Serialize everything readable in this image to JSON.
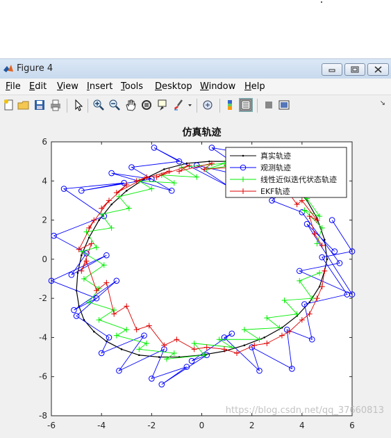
{
  "window": {
    "title": "Figure 4"
  },
  "menu": [
    "File",
    "Edit",
    "View",
    "Insert",
    "Tools",
    "Desktop",
    "Window",
    "Help"
  ],
  "menu_underline": [
    "F",
    "E",
    "V",
    "I",
    "T",
    "D",
    "W",
    "H"
  ],
  "toolbar_icons": [
    "new-figure-icon",
    "open-icon",
    "save-icon",
    "print-icon",
    "pointer-icon",
    "zoom-in-icon",
    "zoom-out-icon",
    "pan-icon",
    "rotate-3d-icon",
    "data-cursor-icon",
    "brush-icon",
    "brush-dropdown-icon",
    "link-plot-icon",
    "colorbar-icon",
    "legend-icon",
    "hide-plot-tools-icon",
    "show-plot-tools-icon"
  ],
  "chart_data": {
    "type": "line",
    "title": "仿真轨迹",
    "xlabel": "",
    "ylabel": "",
    "xlim": [
      -6,
      6
    ],
    "ylim": [
      -8,
      6
    ],
    "xticks": [
      "-6",
      "-4",
      "-2",
      "0",
      "2",
      "4",
      "6"
    ],
    "yticks": [
      "6",
      "4",
      "2",
      "0",
      "-2",
      "-4",
      "-6",
      "-8"
    ],
    "legend_position": "top-right",
    "legend": [
      "真实轨迹",
      "观测轨迹",
      "线性近似迭代状态轨迹",
      "EKF轨迹"
    ],
    "series": [
      {
        "name": "真实轨迹",
        "color": "#000000",
        "marker": "dot",
        "x": [
          5.0,
          4.9,
          4.6,
          4.2,
          3.6,
          2.9,
          2.1,
          1.2,
          0.3,
          -0.6,
          -1.5,
          -2.3,
          -3.0,
          -3.6,
          -4.1,
          -4.5,
          -4.8,
          -4.95,
          -5.0,
          -4.9,
          -4.7,
          -4.3,
          -3.8,
          -3.2,
          -2.5,
          -1.7,
          -0.9,
          0.0,
          0.9,
          1.7,
          2.5,
          3.2,
          3.8,
          4.3,
          4.7,
          4.9,
          5.0
        ],
        "y": [
          0.0,
          1.0,
          2.1,
          3.0,
          3.8,
          4.4,
          4.8,
          5.0,
          5.0,
          4.9,
          4.6,
          4.1,
          3.5,
          2.8,
          2.0,
          1.1,
          0.2,
          -0.7,
          -1.6,
          -2.4,
          -3.1,
          -3.7,
          -4.2,
          -4.6,
          -4.9,
          -5.0,
          -5.0,
          -4.9,
          -4.7,
          -4.4,
          -4.0,
          -3.5,
          -2.9,
          -2.2,
          -1.4,
          -0.6,
          0.0
        ]
      },
      {
        "name": "观测轨迹",
        "color": "#0000ff",
        "marker": "circle",
        "x": [
          5.3,
          4.2,
          6.0,
          3.9,
          5.5,
          4.0,
          2.8,
          4.5,
          1.8,
          3.1,
          0.4,
          2.2,
          -0.2,
          1.1,
          -1.9,
          -0.9,
          -2.8,
          -1.2,
          -3.6,
          -2.0,
          -4.8,
          -3.1,
          -5.5,
          -3.9,
          -5.9,
          -4.6,
          -5.2,
          -3.8,
          -6.0,
          -4.2,
          -5.1,
          -3.4,
          -5.0,
          -3.7,
          -4.0,
          -2.3,
          -3.3,
          -1.5,
          -2.0,
          -0.6,
          -1.6,
          0.2,
          -0.4,
          1.2,
          0.9,
          2.3,
          2.0,
          3.6,
          3.4,
          4.4,
          4.1,
          5.8,
          4.8,
          6.0,
          5.2
        ],
        "y": [
          0.4,
          1.8,
          -1.8,
          -0.6,
          -0.2,
          2.4,
          3.0,
          4.8,
          4.4,
          5.1,
          5.7,
          4.1,
          4.8,
          3.7,
          5.7,
          5.0,
          4.7,
          3.5,
          4.4,
          4.1,
          3.5,
          3.9,
          3.6,
          2.2,
          1.2,
          0.3,
          -0.8,
          0.2,
          -1.1,
          -2.0,
          -2.6,
          -1.1,
          -2.9,
          -4.0,
          -4.8,
          -3.9,
          -5.7,
          -4.6,
          -6.1,
          -5.5,
          -6.4,
          -4.9,
          -5.2,
          -3.8,
          -4.0,
          -5.7,
          -4.5,
          -5.6,
          -3.6,
          -4.1,
          -2.3,
          -1.8,
          0.1,
          0.4,
          2.0
        ]
      },
      {
        "name": "线性近似迭代状态轨迹",
        "color": "#00ee00",
        "marker": "plus",
        "x": [
          4.6,
          4.8,
          4.1,
          4.7,
          4.2,
          3.6,
          3.9,
          2.8,
          3.2,
          2.0,
          2.6,
          1.1,
          1.8,
          0.2,
          0.9,
          -0.8,
          -0.2,
          -1.6,
          -1.1,
          -2.5,
          -2.0,
          -3.3,
          -2.9,
          -4.0,
          -3.6,
          -4.6,
          -4.2,
          -4.8,
          -3.9,
          -4.7,
          -4.1,
          -4.5,
          -3.5,
          -4.1,
          -3.0,
          -3.4,
          -2.2,
          -2.5,
          -1.1,
          -1.4,
          0.1,
          -0.3,
          1.2,
          0.7,
          2.3,
          1.7,
          3.1,
          2.6,
          3.8,
          3.3,
          4.4,
          3.9,
          4.7
        ],
        "y": [
          0.8,
          1.6,
          2.5,
          2.2,
          3.1,
          3.4,
          3.8,
          4.0,
          4.4,
          4.1,
          4.7,
          4.4,
          4.9,
          4.6,
          4.9,
          4.7,
          4.2,
          4.3,
          3.9,
          4.0,
          3.6,
          3.2,
          2.6,
          2.3,
          1.6,
          1.4,
          0.6,
          0.4,
          -0.3,
          -1.0,
          -1.5,
          -2.2,
          -2.6,
          -3.1,
          -3.6,
          -3.9,
          -4.3,
          -4.6,
          -4.8,
          -5.1,
          -4.9,
          -4.3,
          -4.5,
          -4.1,
          -4.1,
          -3.6,
          -3.5,
          -3.0,
          -2.8,
          -2.1,
          -2.0,
          -1.1,
          -0.7
        ]
      },
      {
        "name": "EKF轨迹",
        "color": "#dd0000",
        "marker": "plus",
        "x": [
          4.8,
          4.5,
          4.3,
          4.6,
          4.0,
          3.8,
          3.3,
          3.5,
          2.7,
          2.9,
          1.9,
          2.1,
          1.0,
          1.2,
          0.1,
          0.4,
          -0.9,
          -0.5,
          -1.8,
          -1.3,
          -2.6,
          -2.2,
          -3.4,
          -3.0,
          -4.0,
          -3.7,
          -4.5,
          -4.3,
          -4.9,
          -4.4,
          -4.8,
          -4.6,
          -4.2,
          -3.8,
          -3.5,
          -3.0,
          -2.6,
          -2.1,
          -1.5,
          -1.0,
          -0.3,
          0.2,
          0.9,
          1.4,
          2.1,
          2.6,
          3.2,
          3.5,
          4.0,
          4.3,
          4.6,
          4.8,
          4.9
        ],
        "y": [
          0.7,
          1.3,
          2.2,
          2.0,
          3.0,
          2.8,
          3.7,
          3.6,
          4.2,
          4.4,
          4.6,
          4.5,
          4.8,
          4.7,
          4.6,
          4.9,
          4.5,
          4.8,
          4.2,
          4.5,
          4.0,
          4.2,
          3.4,
          3.8,
          2.6,
          3.0,
          1.6,
          2.0,
          0.5,
          0.8,
          -0.6,
          -0.1,
          -1.6,
          -1.2,
          -2.8,
          -2.4,
          -3.6,
          -3.4,
          -4.4,
          -4.1,
          -4.6,
          -4.5,
          -4.6,
          -4.8,
          -4.4,
          -4.3,
          -3.9,
          -3.7,
          -3.1,
          -2.8,
          -2.0,
          -1.4,
          -0.6
        ]
      }
    ]
  },
  "watermark": "https://blog.csdn.net/qq_37660813"
}
